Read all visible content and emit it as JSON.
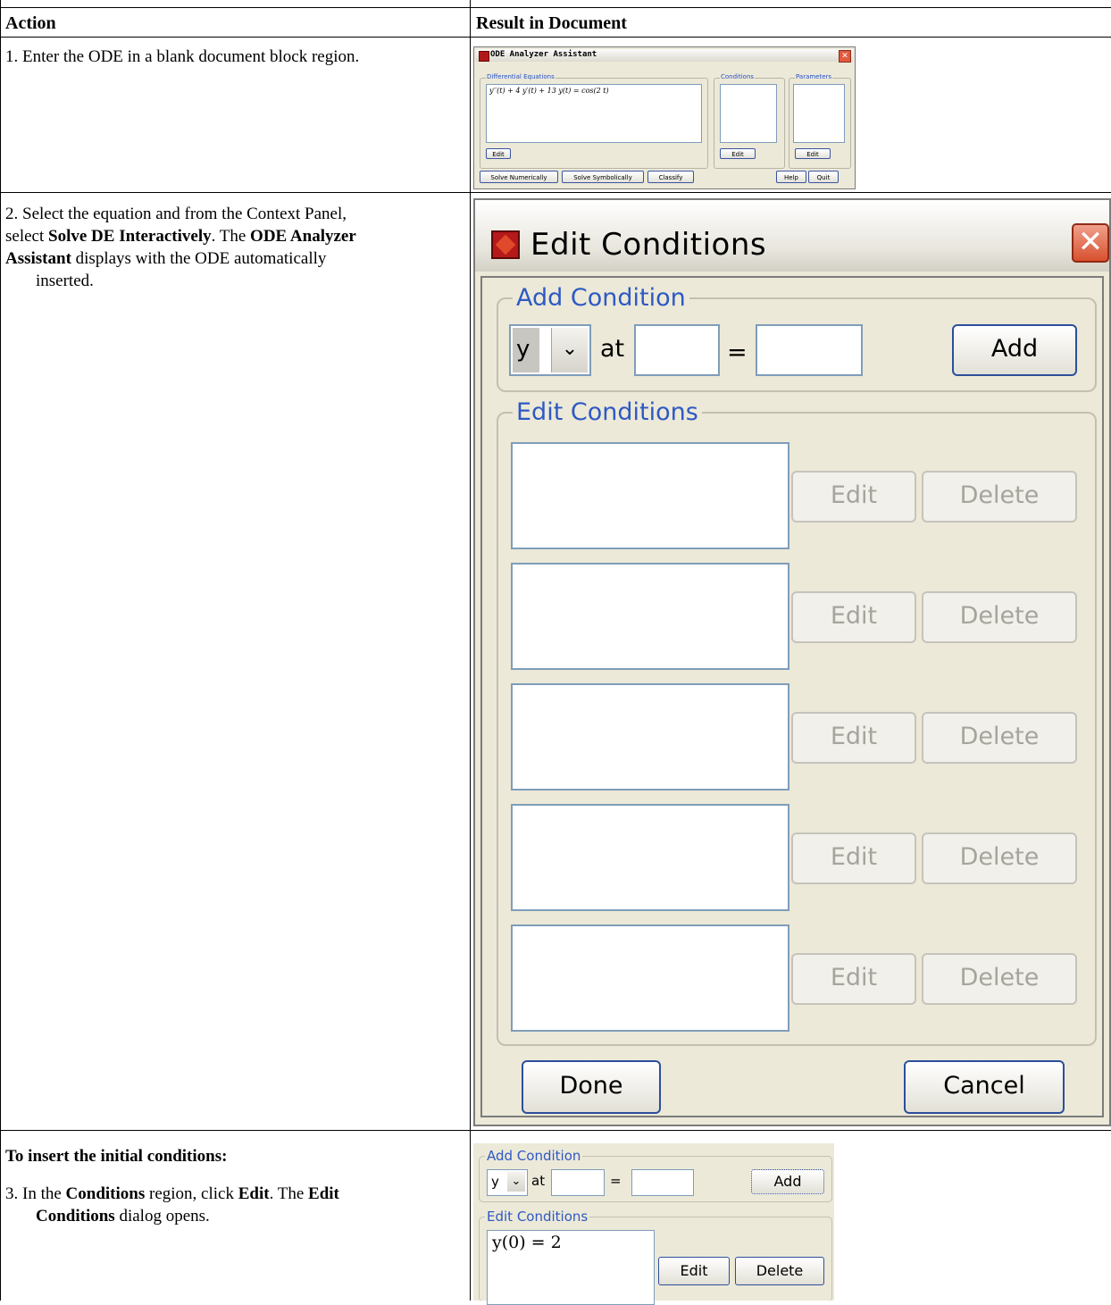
{
  "table": {
    "col_action": "Action",
    "col_result": "Result in Document"
  },
  "rows": {
    "r1": "1. Enter the ODE in a blank document block region.",
    "r2_a": "2. Select the equation and from the Context Panel,",
    "r2_b_pre": "select ",
    "r2_b_bold1": "Solve DE Interactively",
    "r2_b_mid": ". The ",
    "r2_b_bold2": "ODE Analyzer",
    "r2_c_bold": "Assistant",
    "r2_c_rest": " displays with the ODE automatically",
    "r2_d": "inserted.",
    "r3_heading": "To insert the initial conditions:",
    "r3_a_pre": "3. In the ",
    "r3_a_bold1": "Conditions",
    "r3_a_mid": " region, click ",
    "r3_a_bold2": "Edit",
    "r3_a_mid2": ". The ",
    "r3_a_bold3": "Edit",
    "r3_b_bold": "Conditions",
    "r3_b_rest": " dialog opens."
  },
  "mini_window": {
    "title": "ODE Analyzer Assistant",
    "group_equations": "Differential Equations",
    "group_conditions": "Conditions",
    "group_parameters": "Parameters",
    "equation": "y′′(t) + 4 y′(t) + 13 y(t) = cos(2 t)",
    "edit_label": "Edit",
    "btn_solve_num": "Solve Numerically",
    "btn_solve_sym": "Solve Symbolically",
    "btn_classify": "Classify",
    "btn_help": "Help",
    "btn_quit": "Quit"
  },
  "dialog": {
    "title": "Edit Conditions",
    "close_glyph": "✕",
    "add_group": "Add Condition",
    "function_value": "y",
    "arrow_glyph": "⌄",
    "at_label": "at",
    "equals_label": "=",
    "add_button": "Add",
    "edit_group": "Edit Conditions",
    "edit_button": "Edit",
    "delete_button": "Delete",
    "done_button": "Done",
    "cancel_button": "Cancel"
  },
  "snippet": {
    "add_group": "Add Condition",
    "function_value": "y",
    "arrow_glyph": "⌄",
    "at_label": "at",
    "equals_label": "=",
    "add_button": "Add",
    "edit_group": "Edit Conditions",
    "condition": "y(0) = 2",
    "edit_button": "Edit",
    "delete_button": "Delete"
  }
}
